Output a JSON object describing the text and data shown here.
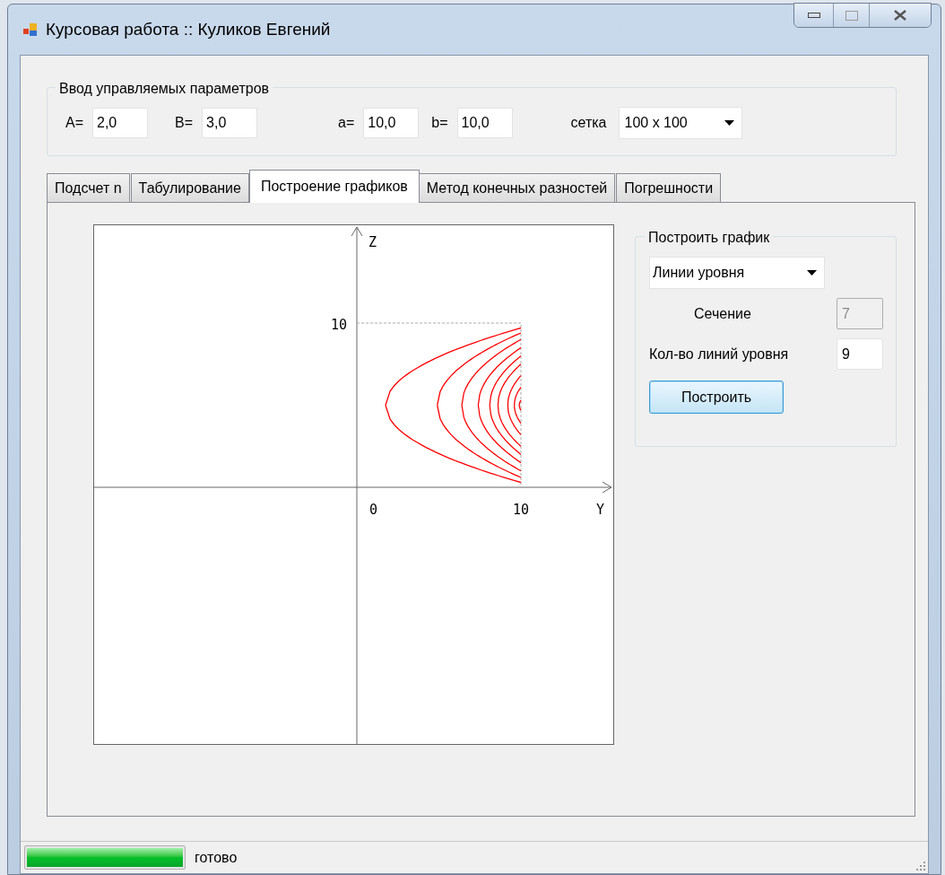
{
  "window": {
    "title": "Курсовая работа :: Куликов Евгений"
  },
  "params": {
    "title": "Ввод управляемых параметров",
    "fields": [
      {
        "label": "A=",
        "value": "2,0"
      },
      {
        "label": "B=",
        "value": "3,0"
      },
      {
        "label": "a=",
        "value": "10,0"
      },
      {
        "label": "b=",
        "value": "10,0"
      }
    ],
    "grid": {
      "label": "сетка",
      "value": "100 x 100"
    }
  },
  "tabs": [
    {
      "label": "Подсчет n",
      "selected": false
    },
    {
      "label": "Табулирование",
      "selected": false
    },
    {
      "label": "Построение графиков",
      "selected": true
    },
    {
      "label": "Метод конечных разностей",
      "selected": false
    },
    {
      "label": "Погрешности",
      "selected": false
    }
  ],
  "plot": {
    "z_axis_label": "Z",
    "y_axis_label": "Y",
    "z_tick": "10",
    "origin_label": "0",
    "y_tick": "10"
  },
  "build_panel": {
    "title": "Построить график",
    "mode": "Линии уровня",
    "fields": [
      {
        "label": "Сечение",
        "value": "7",
        "disabled": true
      },
      {
        "label": "Кол-во линий уровня",
        "value": "9",
        "disabled": false
      }
    ],
    "button": "Построить"
  },
  "status_bar": {
    "progress": {
      "level": 1
    },
    "text": "готово"
  }
}
